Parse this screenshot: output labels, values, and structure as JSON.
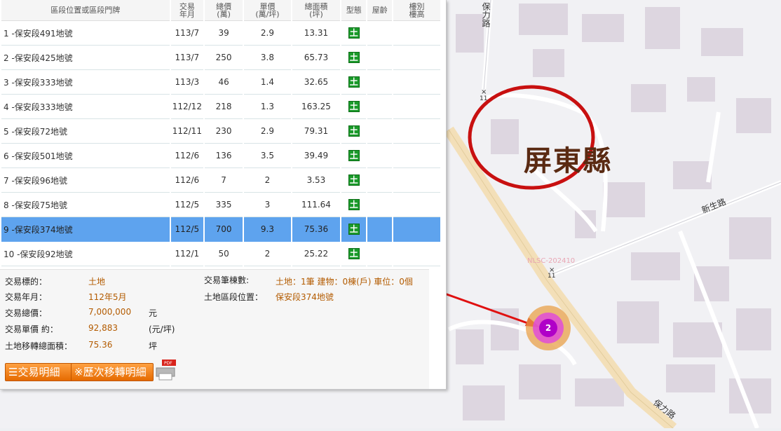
{
  "table": {
    "headers": [
      "區段位置或區段門牌",
      "交易\n年月",
      "總價\n(萬)",
      "單價\n(萬/坪)",
      "總面積\n(坪)",
      "型態",
      "屋齡",
      "樓別\n樓高"
    ],
    "rows": [
      {
        "addr": "1 -保安段491地號",
        "date": "113/7",
        "total": "39",
        "unit": "2.9",
        "area": "13.31"
      },
      {
        "addr": "2 -保安段425地號",
        "date": "113/7",
        "total": "250",
        "unit": "3.8",
        "area": "65.73"
      },
      {
        "addr": "3 -保安段333地號",
        "date": "113/3",
        "total": "46",
        "unit": "1.4",
        "area": "32.65"
      },
      {
        "addr": "4 -保安段333地號",
        "date": "112/12",
        "total": "218",
        "unit": "1.3",
        "area": "163.25"
      },
      {
        "addr": "5 -保安段72地號",
        "date": "112/11",
        "total": "230",
        "unit": "2.9",
        "area": "79.31"
      },
      {
        "addr": "6 -保安段501地號",
        "date": "112/6",
        "total": "136",
        "unit": "3.5",
        "area": "39.49"
      },
      {
        "addr": "7 -保安段96地號",
        "date": "112/6",
        "total": "7",
        "unit": "2",
        "area": "3.53"
      },
      {
        "addr": "8 -保安段75地號",
        "date": "112/5",
        "total": "335",
        "unit": "3",
        "area": "111.64"
      },
      {
        "addr": "9 -保安段374地號",
        "date": "112/5",
        "total": "700",
        "unit": "9.3",
        "area": "75.36"
      },
      {
        "addr": "10 -保安段92地號",
        "date": "112/1",
        "total": "50",
        "unit": "2",
        "area": "25.22"
      }
    ],
    "type_icon": "土"
  },
  "detail": {
    "target_label": "交易標的：",
    "target_value": "土地",
    "date_label": "交易年月：",
    "date_value": "112年5月",
    "total_label": "交易總價：",
    "total_value": "7,000,000",
    "total_unit": "元",
    "unit_label": "交易單價 約：",
    "unit_value": "92,883",
    "unit_unit": "(元/坪)",
    "area_label": "土地移轉總面積：",
    "area_value": "75.36",
    "area_unit": "坪",
    "count_label": "交易筆棟數:",
    "count_value": "土地：1筆 建物：0棟(戶) 車位：0個",
    "loc_label": "土地區段位置：",
    "loc_value": "保安段374地號"
  },
  "buttons": {
    "detail_btn": "☰交易明細",
    "history_btn": "※歷次移轉明細",
    "pdf_label": "PDF"
  },
  "map": {
    "county": "屏東縣",
    "road_baoli_top": "保力路",
    "road_xinsheng": "新生路",
    "road_baoli_bottom": "保力路",
    "nlsc": "NLSC-202410",
    "route_num_1": "11",
    "route_num_2": "11",
    "cluster_count": "2"
  },
  "colors": {
    "selected_row": "#5ea3ee",
    "accent": "#e56a00",
    "annotation_red": "#e01010",
    "cluster": "#c800d8"
  }
}
